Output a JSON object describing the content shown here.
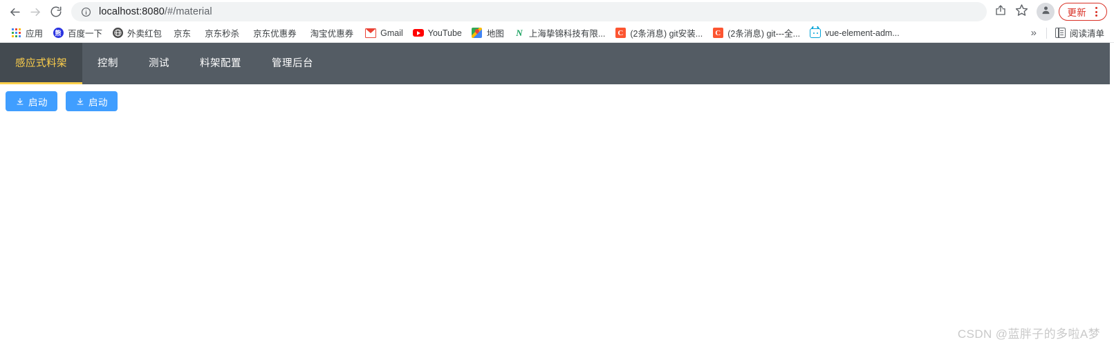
{
  "browser": {
    "nav": {
      "back_icon": "back-arrow-icon",
      "forward_icon": "forward-arrow-icon",
      "reload_icon": "reload-icon"
    },
    "omnibox": {
      "info_icon": "site-info-icon",
      "url_host": "localhost:8080",
      "url_path": "/#/material",
      "full_url": "localhost:8080/#/material"
    },
    "actions": {
      "share_icon": "share-icon",
      "bookmark_icon": "star-icon",
      "profile_icon": "profile-avatar-icon",
      "update_label": "更新",
      "menu_icon": "kebab-menu-icon"
    },
    "bookmarks": [
      {
        "label": "应用",
        "icon": "apps-grid-icon"
      },
      {
        "label": "百度一下",
        "icon": "baidu-icon"
      },
      {
        "label": "外卖红包",
        "icon": "globe-icon"
      },
      {
        "label": "京东",
        "icon": "none"
      },
      {
        "label": "京东秒杀",
        "icon": "none"
      },
      {
        "label": "京东优惠券",
        "icon": "none"
      },
      {
        "label": "淘宝优惠券",
        "icon": "none"
      },
      {
        "label": "Gmail",
        "icon": "gmail-icon"
      },
      {
        "label": "YouTube",
        "icon": "youtube-icon"
      },
      {
        "label": "地图",
        "icon": "google-maps-icon"
      },
      {
        "label": "上海挚锦科技有限...",
        "icon": "n-logo-icon"
      },
      {
        "label": "(2条消息) git安装...",
        "icon": "csdn-icon"
      },
      {
        "label": "(2条消息) git---全...",
        "icon": "csdn-icon"
      },
      {
        "label": "vue-element-adm...",
        "icon": "bilibili-tv-icon"
      }
    ],
    "overflow_label": "»",
    "reading_list": {
      "label": "阅读清单",
      "icon": "reading-list-icon"
    }
  },
  "app": {
    "navbar": {
      "items": [
        {
          "label": "感应式料架",
          "active": true
        },
        {
          "label": "控制",
          "active": false
        },
        {
          "label": "测试",
          "active": false
        },
        {
          "label": "料架配置",
          "active": false
        },
        {
          "label": "管理后台",
          "active": false
        }
      ],
      "background_color": "#545c64",
      "active_background_color": "#434a50",
      "active_text_color": "#ffd04b"
    },
    "toolbar": {
      "buttons": [
        {
          "label": "启动",
          "icon": "download-icon"
        },
        {
          "label": "启动",
          "icon": "download-icon"
        }
      ],
      "button_color": "#409eff"
    }
  },
  "watermark": {
    "text": "CSDN @蓝胖子的多啦A梦"
  }
}
